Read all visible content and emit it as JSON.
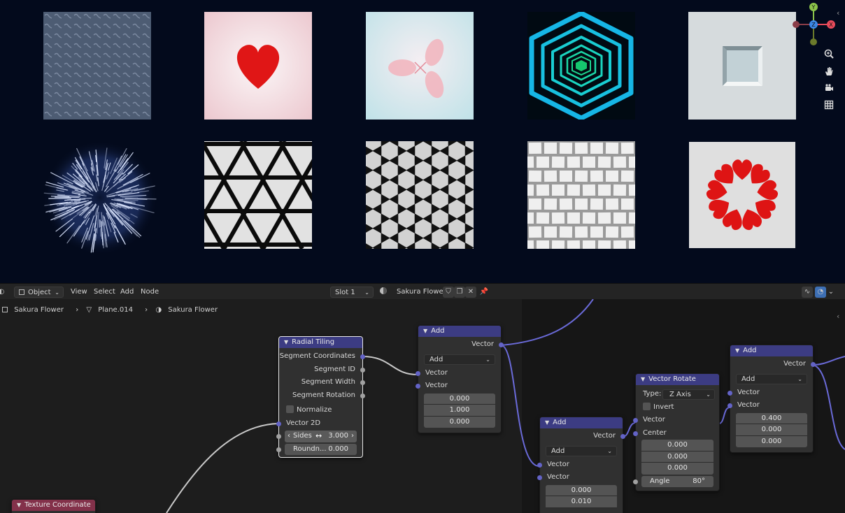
{
  "viewport": {
    "textures": [
      {
        "name": "wave-pattern"
      },
      {
        "name": "heart"
      },
      {
        "name": "sakura-flower"
      },
      {
        "name": "hexagon-tunnel"
      },
      {
        "name": "inset-square"
      },
      {
        "name": "firework-burst"
      },
      {
        "name": "triangle-grid"
      },
      {
        "name": "hexagon-grid"
      },
      {
        "name": "brick-tiles"
      },
      {
        "name": "heart-ring"
      }
    ],
    "gizmo": {
      "x": "X",
      "y": "Y",
      "z": "Z"
    }
  },
  "header": {
    "mode": "Object",
    "menus": [
      "View",
      "Select",
      "Add",
      "Node"
    ],
    "slot": "Slot 1",
    "material": "Sakura Flower"
  },
  "breadcrumb": [
    "Sakura Flower",
    "Plane.014",
    "Sakura Flower"
  ],
  "nodes": {
    "radial_tiling": {
      "title": "Radial Tiling",
      "outputs": [
        "Segment Coordinates",
        "Segment ID",
        "Segment Width",
        "Segment Rotation"
      ],
      "normalize": "Normalize",
      "input": "Vector 2D",
      "sides_label": "Sides",
      "sides_value": "3.000",
      "round_label": "Roundn...",
      "round_value": "0.000"
    },
    "add1": {
      "title": "Add",
      "output": "Vector",
      "op": "Add",
      "in1": "Vector",
      "in2": "Vector",
      "values": [
        "0.000",
        "1.000",
        "0.000"
      ]
    },
    "add2": {
      "title": "Add",
      "output": "Vector",
      "op": "Add",
      "in1": "Vector",
      "in2": "Vector",
      "values": [
        "0.000",
        "0.010"
      ]
    },
    "vector_rotate": {
      "title": "Vector Rotate",
      "type_label": "Type:",
      "type_value": "Z Axis",
      "invert": "Invert",
      "in_vector": "Vector",
      "in_center": "Center",
      "values": [
        "0.000",
        "0.000",
        "0.000"
      ],
      "angle_label": "Angle",
      "angle_value": "80°"
    },
    "add3": {
      "title": "Add",
      "output": "Vector",
      "op": "Add",
      "in1": "Vector",
      "in2": "Vector",
      "values": [
        "0.400",
        "0.000",
        "0.000"
      ]
    },
    "tex_coord": {
      "title": "Texture Coordinate"
    }
  }
}
